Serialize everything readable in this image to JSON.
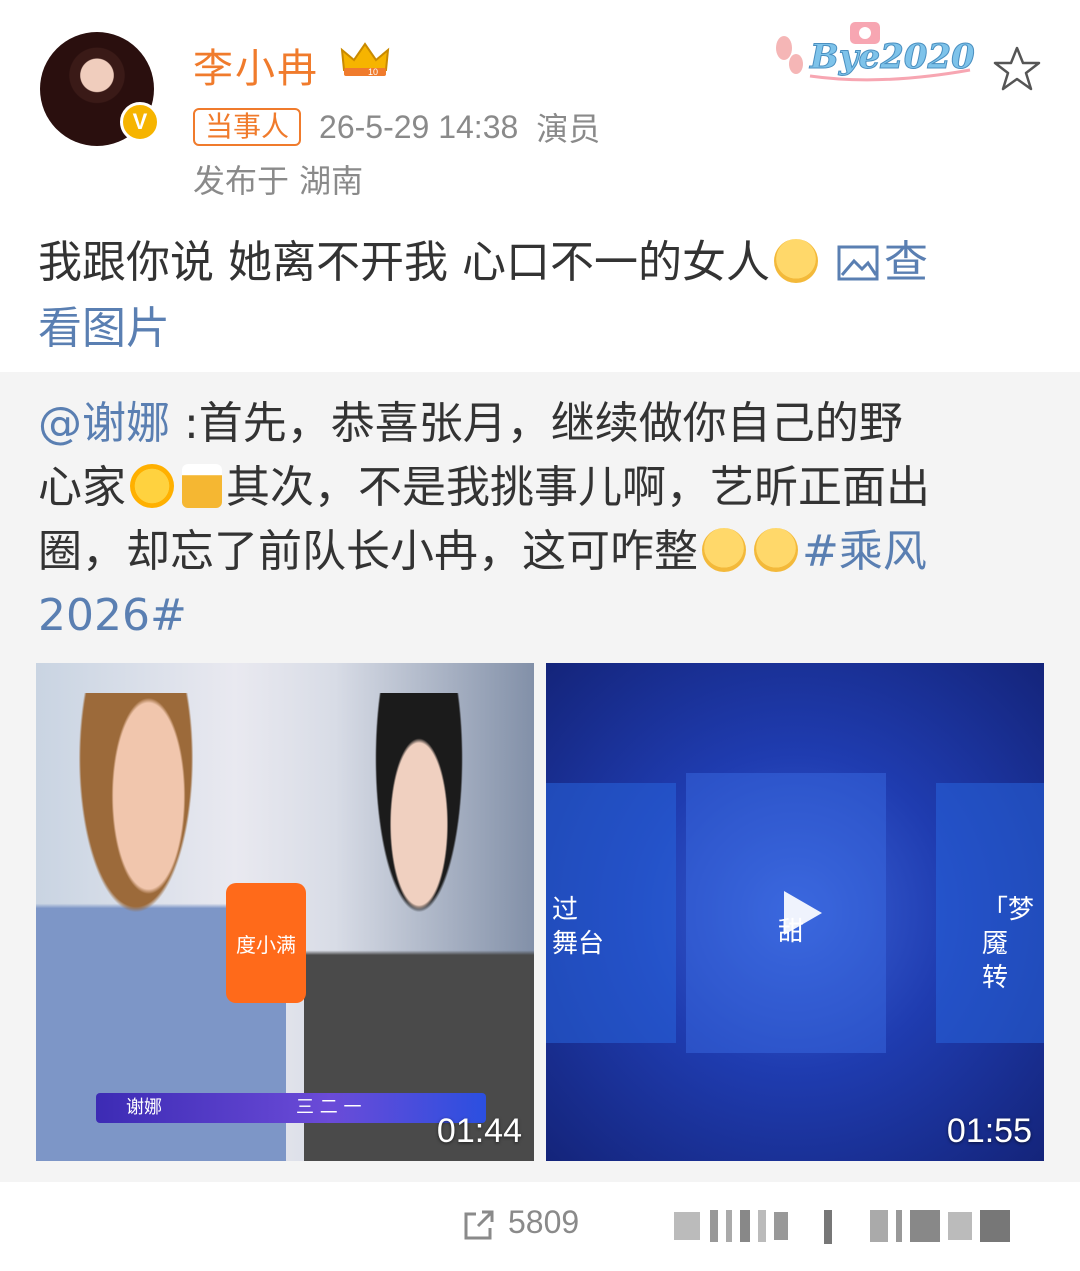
{
  "post": {
    "username": "李小冉",
    "level_badge": "10",
    "verified_badge": "V",
    "tag": "当事人",
    "timestamp": "26-5-29 14:38",
    "role": "演员",
    "location": "发布于 湖南",
    "text_main": "我跟你说 她离不开我 心口不一的女人",
    "view_images_part1": "查",
    "view_images_part2": "看图片",
    "sticker_text": "Bye2020"
  },
  "repost": {
    "mention": "@谢娜",
    "text1": " :首先，恭喜张月，继续做你自己的野",
    "text2": "心家",
    "text3": "其次，不是我挑事儿啊，艺昕正面出",
    "text4": "圈，却忘了前队长小冉，这可咋整",
    "hashtag_part1": "#乘风",
    "hashtag_part2": "2026#",
    "videos": [
      {
        "duration": "01:44",
        "caption_name": "谢娜",
        "caption_right": "三 二 一",
        "sign_text": "度小满"
      },
      {
        "duration": "01:55",
        "panel_left_text": "过\n舞台",
        "panel_right_text": "「梦魇\n转",
        "center_text": "甜"
      }
    ]
  },
  "actions": {
    "share_count": "5809"
  },
  "colors": {
    "username": "#f07b2c",
    "link": "#5a7fb2",
    "meta": "#8a8a8a",
    "repost_bg": "#f4f4f4"
  },
  "icons": [
    "verified-icon",
    "crown-badge-icon",
    "star-icon",
    "shush-emoji-icon",
    "image-icon",
    "sun-emoji-icon",
    "beer-emoji-icon",
    "thinking-emoji-icon",
    "grin-emoji-icon",
    "play-icon",
    "share-icon"
  ]
}
